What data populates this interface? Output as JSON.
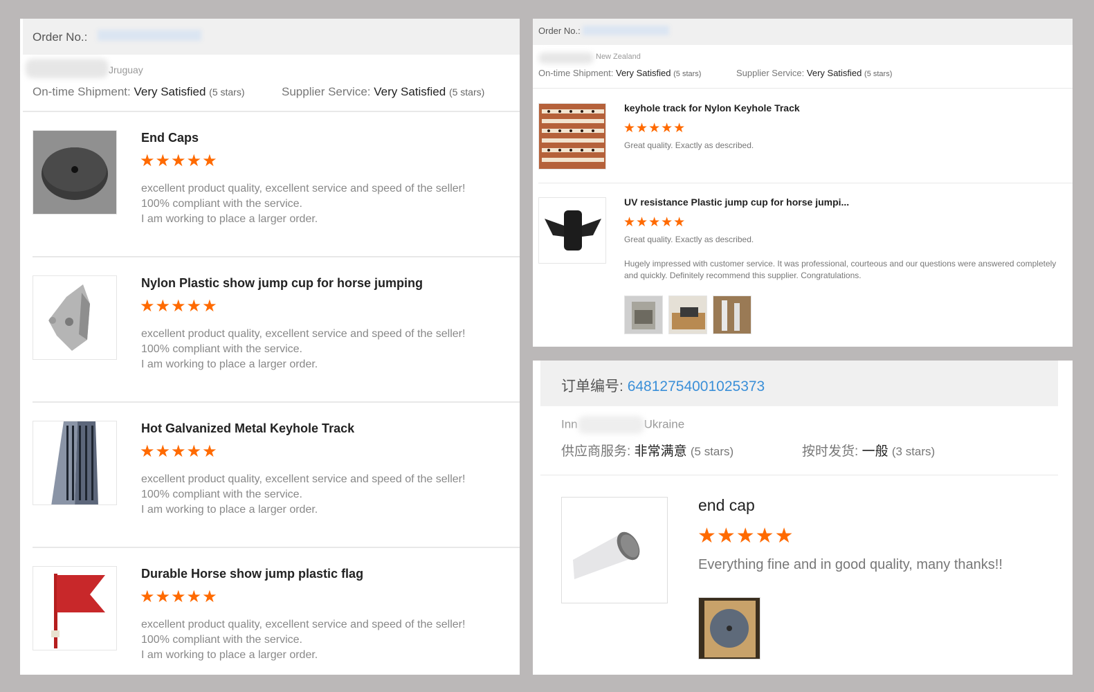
{
  "panel1": {
    "order_label": "Order No.:",
    "buyer_country": "Jruguay",
    "shipment_label": "On-time Shipment:",
    "shipment_value": "Very Satisfied",
    "shipment_stars": "(5 stars)",
    "service_label": "Supplier Service:",
    "service_value": "Very Satisfied",
    "service_stars": "(5 stars)",
    "items": [
      {
        "title": "End Caps",
        "stars": "★★★★★",
        "line1": "excellent product quality, excellent service and speed of the seller!",
        "line2": "100% compliant with the service.",
        "line3": "I am working to place a larger order."
      },
      {
        "title": "Nylon Plastic show jump cup for horse jumping",
        "stars": "★★★★★",
        "line1": "excellent product quality, excellent service and speed of the seller!",
        "line2": "100% compliant with the service.",
        "line3": "I am working to place a larger order."
      },
      {
        "title": "Hot Galvanized Metal Keyhole Track",
        "stars": "★★★★★",
        "line1": "excellent product quality, excellent service and speed of the seller!",
        "line2": "100% compliant with the service.",
        "line3": "I am working to place a larger order."
      },
      {
        "title": "Durable Horse show jump plastic flag",
        "stars": "★★★★★",
        "line1": "excellent product quality, excellent service and speed of the seller!",
        "line2": "100% compliant with the service.",
        "line3": "I am working to place a larger order."
      }
    ]
  },
  "panel2": {
    "order_label": "Order No.:",
    "buyer_country": "New Zealand",
    "shipment_label": "On-time Shipment:",
    "shipment_value": "Very Satisfied",
    "shipment_stars": "(5 stars)",
    "service_label": "Supplier Service:",
    "service_value": "Very Satisfied",
    "service_stars": "(5 stars)",
    "items": [
      {
        "title": "keyhole track for Nylon Keyhole Track",
        "stars": "★★★★★",
        "review": "Great quality. Exactly as described."
      },
      {
        "title": "UV resistance Plastic jump cup for horse jumpi...",
        "stars": "★★★★★",
        "review": "Great quality. Exactly as described.",
        "followup": "Hugely impressed with customer service. It was professional, courteous and our questions were answered completely and quickly. Definitely recommend this supplier. Congratulations."
      }
    ]
  },
  "panel3": {
    "order_label": "订单编号:",
    "order_number": "64812754001025373",
    "buyer_prefix": "Inn",
    "buyer_country": "Ukraine",
    "service_label": "供应商服务:",
    "service_value": "非常满意",
    "service_stars": "(5 stars)",
    "shipment_label": "按时发货:",
    "shipment_value": "一般",
    "shipment_stars": "(3 stars)",
    "item": {
      "title": "end cap",
      "stars": "★★★★★",
      "review": "Everything fine and in good quality, many thanks!!"
    }
  }
}
